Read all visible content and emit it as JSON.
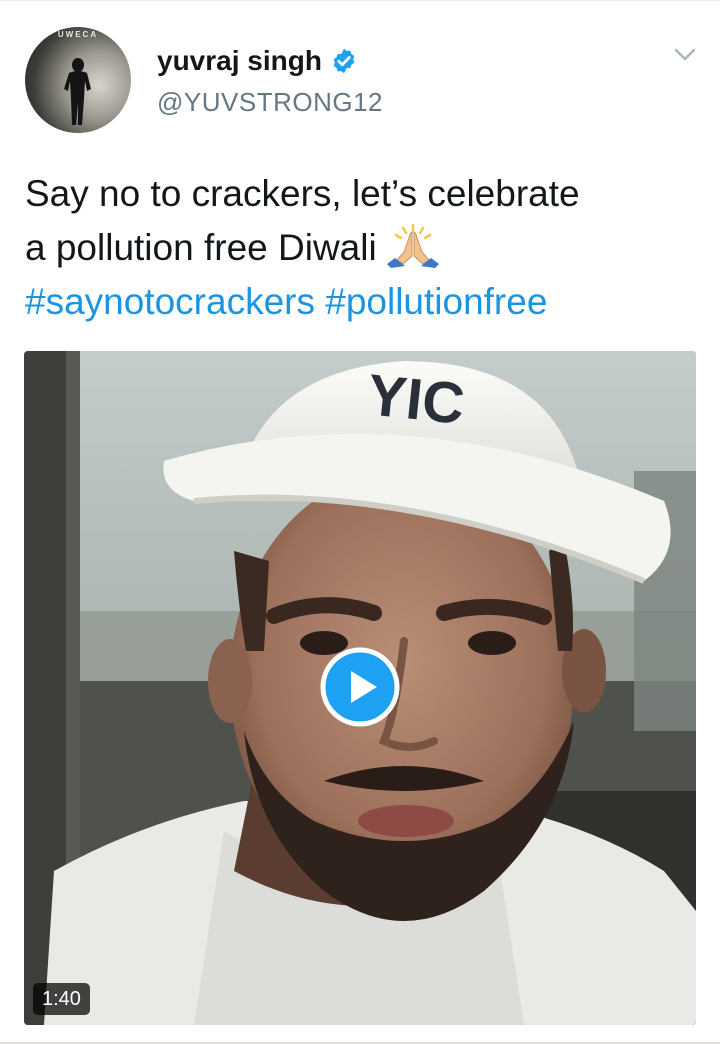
{
  "tweet": {
    "author_name": "yuvraj singh",
    "author_handle": "@YUVSTRONG12",
    "avatar_brand_text": "UWECA",
    "text_lines": [
      "Say no to crackers, let’s celebrate",
      "a pollution free Diwali"
    ],
    "hashtags": [
      "#saynotocrackers",
      "#pollutionfree"
    ],
    "emoji": "folded-hands-emoji"
  },
  "video": {
    "duration": "1:40",
    "cap_text": "YIC"
  },
  "icons": {
    "verified": "verified-badge-icon",
    "caret": "chevron-down-icon",
    "play": "play-icon"
  },
  "colors": {
    "hashtag": "#1b95e0",
    "verified": "#1da1f2",
    "play": "#1da1f2",
    "handle": "#657786",
    "text": "#14171a"
  }
}
